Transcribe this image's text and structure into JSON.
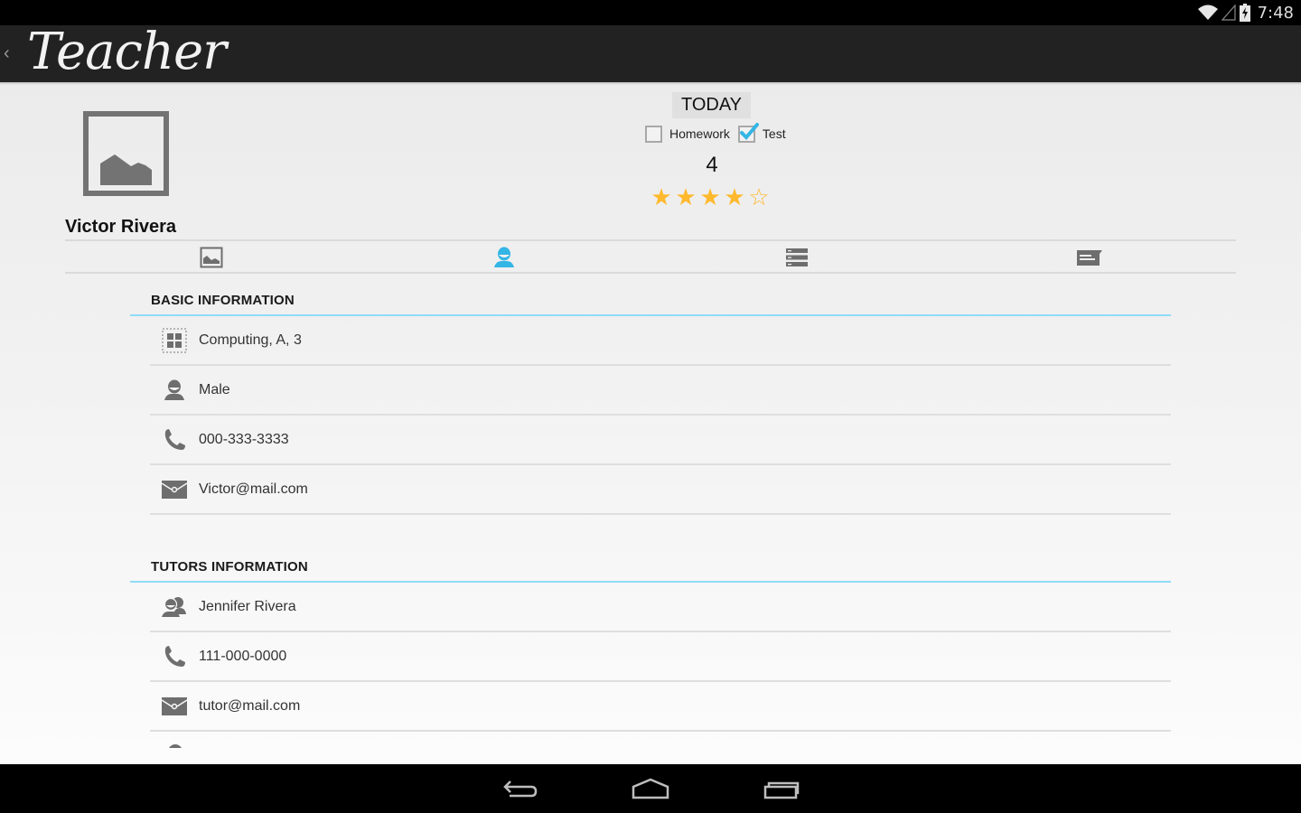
{
  "status_bar": {
    "time": "7:48",
    "icons": [
      "wifi-icon",
      "cell-signal-icon",
      "battery-charging-icon"
    ]
  },
  "action_bar": {
    "back_icon": "chevron-left-icon",
    "title": "Teacher"
  },
  "student": {
    "name": "Victor Rivera",
    "photo_icon": "image-placeholder-icon"
  },
  "today": {
    "button_label": "TODAY",
    "checkboxes": [
      {
        "label": "Homework",
        "checked": false
      },
      {
        "label": "Test",
        "checked": true
      }
    ],
    "score": "4",
    "rating": {
      "value": 4,
      "max": 5
    },
    "star_filled_color": "#ffb92e"
  },
  "tabs": [
    {
      "icon": "image-icon",
      "active": false
    },
    {
      "icon": "person-icon",
      "active": true
    },
    {
      "icon": "list-icon",
      "active": false
    },
    {
      "icon": "comment-icon",
      "active": false
    }
  ],
  "accent_color": "#33b5e5",
  "basic_info": {
    "header": "BASIC INFORMATION",
    "rows": [
      {
        "icon": "class-grid-icon",
        "text": "Computing, A, 3"
      },
      {
        "icon": "person-icon",
        "text": "Male"
      },
      {
        "icon": "phone-icon",
        "text": "000-333-3333"
      },
      {
        "icon": "email-icon",
        "text": "Victor@mail.com"
      }
    ]
  },
  "tutors_info": {
    "header": "TUTORS INFORMATION",
    "rows": [
      {
        "icon": "people-icon",
        "text": "Jennifer Rivera"
      },
      {
        "icon": "phone-icon",
        "text": "111-000-0000"
      },
      {
        "icon": "email-icon",
        "text": "tutor@mail.com"
      }
    ]
  },
  "nav_bar": {
    "buttons": [
      "back-icon",
      "home-icon",
      "recent-apps-icon"
    ]
  }
}
